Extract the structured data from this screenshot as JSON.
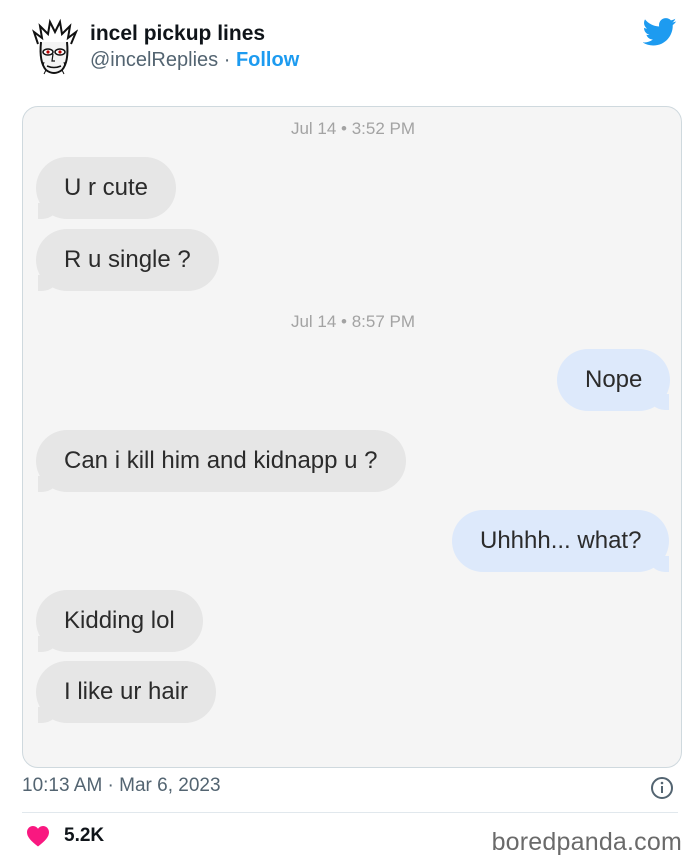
{
  "tweet": {
    "display_name": "incel pickup lines",
    "handle": "@incelReplies",
    "separator": "·",
    "follow_label": "Follow",
    "timestamp": "10:13 AM · Mar 6, 2023",
    "likes": "5.2K",
    "brand_color": "#1d9bf0",
    "like_color": "#f91880"
  },
  "chat": {
    "timestamps": [
      "Jul 14 • 3:52 PM",
      "Jul 14 • 8:57 PM"
    ],
    "messages": [
      {
        "side": "incoming",
        "text": "U r cute"
      },
      {
        "side": "incoming",
        "text": "R u single ?"
      },
      {
        "side": "outgoing",
        "text": "Nope"
      },
      {
        "side": "incoming",
        "text": "Can i kill him and kidnapp u ?"
      },
      {
        "side": "outgoing",
        "text": "Uhhhh... what?"
      },
      {
        "side": "incoming",
        "text": "Kidding lol"
      },
      {
        "side": "incoming",
        "text": "I like ur hair"
      }
    ],
    "incoming_color": "#e6e6e6",
    "outgoing_color": "#dde9fb"
  },
  "watermark": "boredpanda.com",
  "icons": [
    "avatar",
    "twitter-bird-icon",
    "info-icon",
    "heart-icon"
  ]
}
